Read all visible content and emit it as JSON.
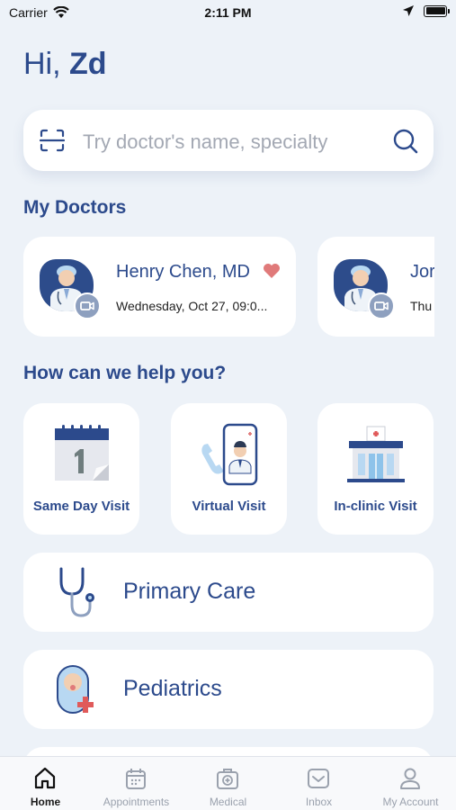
{
  "status": {
    "carrier": "Carrier",
    "time": "2:11 PM"
  },
  "greeting": {
    "prefix": "Hi, ",
    "name": "Zd"
  },
  "search": {
    "placeholder": "Try doctor's name, specialty"
  },
  "my_doctors": {
    "title": "My Doctors",
    "cards": [
      {
        "name": "Henry Chen, MD",
        "date": "Wednesday, Oct 27, 09:0...",
        "favorite": true,
        "icon": "video-icon"
      },
      {
        "name": "Jor",
        "date": "Thu",
        "icon": "video-icon"
      }
    ]
  },
  "help": {
    "title": "How can we help you?",
    "visits": [
      {
        "label": "Same Day Visit",
        "icon": "calendar-icon"
      },
      {
        "label": "Virtual Visit",
        "icon": "phone-doctor-icon"
      },
      {
        "label": "In-clinic Visit",
        "icon": "clinic-icon"
      }
    ]
  },
  "care": [
    {
      "label": "Primary Care",
      "icon": "stethoscope-icon"
    },
    {
      "label": "Pediatrics",
      "icon": "baby-icon"
    }
  ],
  "tabs": [
    {
      "label": "Home",
      "icon": "home-icon",
      "active": true
    },
    {
      "label": "Appointments",
      "icon": "calendar-icon"
    },
    {
      "label": "Medical",
      "icon": "medical-kit-icon"
    },
    {
      "label": "Inbox",
      "icon": "inbox-icon"
    },
    {
      "label": "My Account",
      "icon": "user-icon"
    }
  ],
  "colors": {
    "primary": "#2c4a8c",
    "background": "#edf2f8",
    "heart": "#e07a7a",
    "badge": "#8ea0bf"
  }
}
